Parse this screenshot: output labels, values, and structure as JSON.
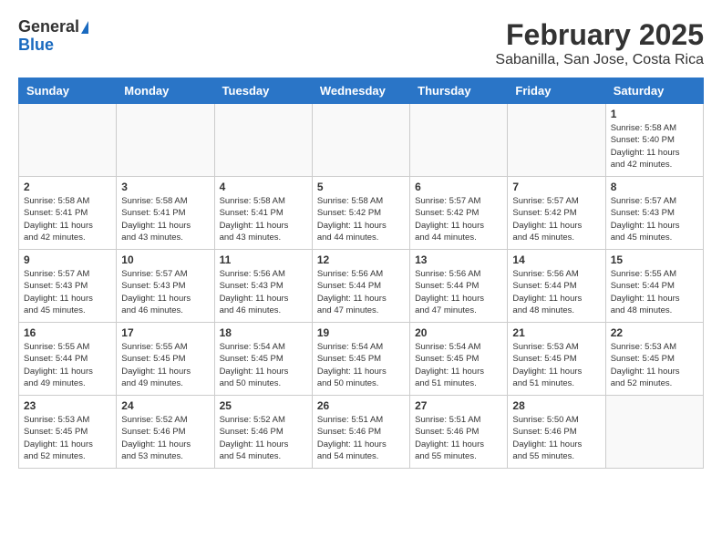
{
  "header": {
    "logo_line1": "General",
    "logo_line2": "Blue",
    "title": "February 2025",
    "subtitle": "Sabanilla, San Jose, Costa Rica"
  },
  "days_of_week": [
    "Sunday",
    "Monday",
    "Tuesday",
    "Wednesday",
    "Thursday",
    "Friday",
    "Saturday"
  ],
  "weeks": [
    [
      {
        "day": "",
        "info": ""
      },
      {
        "day": "",
        "info": ""
      },
      {
        "day": "",
        "info": ""
      },
      {
        "day": "",
        "info": ""
      },
      {
        "day": "",
        "info": ""
      },
      {
        "day": "",
        "info": ""
      },
      {
        "day": "1",
        "info": "Sunrise: 5:58 AM\nSunset: 5:40 PM\nDaylight: 11 hours\nand 42 minutes."
      }
    ],
    [
      {
        "day": "2",
        "info": "Sunrise: 5:58 AM\nSunset: 5:41 PM\nDaylight: 11 hours\nand 42 minutes."
      },
      {
        "day": "3",
        "info": "Sunrise: 5:58 AM\nSunset: 5:41 PM\nDaylight: 11 hours\nand 43 minutes."
      },
      {
        "day": "4",
        "info": "Sunrise: 5:58 AM\nSunset: 5:41 PM\nDaylight: 11 hours\nand 43 minutes."
      },
      {
        "day": "5",
        "info": "Sunrise: 5:58 AM\nSunset: 5:42 PM\nDaylight: 11 hours\nand 44 minutes."
      },
      {
        "day": "6",
        "info": "Sunrise: 5:57 AM\nSunset: 5:42 PM\nDaylight: 11 hours\nand 44 minutes."
      },
      {
        "day": "7",
        "info": "Sunrise: 5:57 AM\nSunset: 5:42 PM\nDaylight: 11 hours\nand 45 minutes."
      },
      {
        "day": "8",
        "info": "Sunrise: 5:57 AM\nSunset: 5:43 PM\nDaylight: 11 hours\nand 45 minutes."
      }
    ],
    [
      {
        "day": "9",
        "info": "Sunrise: 5:57 AM\nSunset: 5:43 PM\nDaylight: 11 hours\nand 45 minutes."
      },
      {
        "day": "10",
        "info": "Sunrise: 5:57 AM\nSunset: 5:43 PM\nDaylight: 11 hours\nand 46 minutes."
      },
      {
        "day": "11",
        "info": "Sunrise: 5:56 AM\nSunset: 5:43 PM\nDaylight: 11 hours\nand 46 minutes."
      },
      {
        "day": "12",
        "info": "Sunrise: 5:56 AM\nSunset: 5:44 PM\nDaylight: 11 hours\nand 47 minutes."
      },
      {
        "day": "13",
        "info": "Sunrise: 5:56 AM\nSunset: 5:44 PM\nDaylight: 11 hours\nand 47 minutes."
      },
      {
        "day": "14",
        "info": "Sunrise: 5:56 AM\nSunset: 5:44 PM\nDaylight: 11 hours\nand 48 minutes."
      },
      {
        "day": "15",
        "info": "Sunrise: 5:55 AM\nSunset: 5:44 PM\nDaylight: 11 hours\nand 48 minutes."
      }
    ],
    [
      {
        "day": "16",
        "info": "Sunrise: 5:55 AM\nSunset: 5:44 PM\nDaylight: 11 hours\nand 49 minutes."
      },
      {
        "day": "17",
        "info": "Sunrise: 5:55 AM\nSunset: 5:45 PM\nDaylight: 11 hours\nand 49 minutes."
      },
      {
        "day": "18",
        "info": "Sunrise: 5:54 AM\nSunset: 5:45 PM\nDaylight: 11 hours\nand 50 minutes."
      },
      {
        "day": "19",
        "info": "Sunrise: 5:54 AM\nSunset: 5:45 PM\nDaylight: 11 hours\nand 50 minutes."
      },
      {
        "day": "20",
        "info": "Sunrise: 5:54 AM\nSunset: 5:45 PM\nDaylight: 11 hours\nand 51 minutes."
      },
      {
        "day": "21",
        "info": "Sunrise: 5:53 AM\nSunset: 5:45 PM\nDaylight: 11 hours\nand 51 minutes."
      },
      {
        "day": "22",
        "info": "Sunrise: 5:53 AM\nSunset: 5:45 PM\nDaylight: 11 hours\nand 52 minutes."
      }
    ],
    [
      {
        "day": "23",
        "info": "Sunrise: 5:53 AM\nSunset: 5:45 PM\nDaylight: 11 hours\nand 52 minutes."
      },
      {
        "day": "24",
        "info": "Sunrise: 5:52 AM\nSunset: 5:46 PM\nDaylight: 11 hours\nand 53 minutes."
      },
      {
        "day": "25",
        "info": "Sunrise: 5:52 AM\nSunset: 5:46 PM\nDaylight: 11 hours\nand 54 minutes."
      },
      {
        "day": "26",
        "info": "Sunrise: 5:51 AM\nSunset: 5:46 PM\nDaylight: 11 hours\nand 54 minutes."
      },
      {
        "day": "27",
        "info": "Sunrise: 5:51 AM\nSunset: 5:46 PM\nDaylight: 11 hours\nand 55 minutes."
      },
      {
        "day": "28",
        "info": "Sunrise: 5:50 AM\nSunset: 5:46 PM\nDaylight: 11 hours\nand 55 minutes."
      },
      {
        "day": "",
        "info": ""
      }
    ]
  ]
}
